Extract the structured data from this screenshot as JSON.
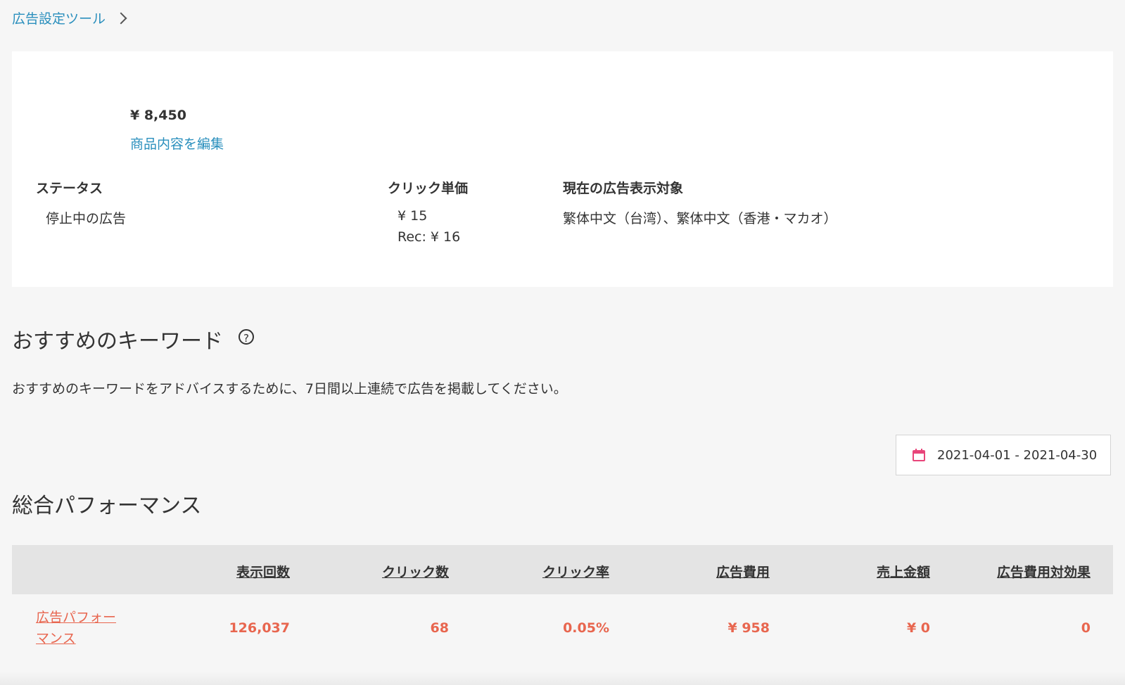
{
  "breadcrumb": {
    "link_label": "広告設定ツール"
  },
  "product": {
    "price": "¥ 8,450",
    "edit_label": "商品内容を編集"
  },
  "details": {
    "status_label": "ステータス",
    "status_value": "停止中の広告",
    "cpc_label": "クリック単価",
    "cpc_value": "¥ 15",
    "cpc_recommended": "Rec: ¥ 16",
    "target_label": "現在の広告表示対象",
    "target_value": "繁体中文（台湾）、繁体中文（香港・マカオ）"
  },
  "keywords": {
    "title": "おすすめのキーワード",
    "help_icon": "question-circle-icon",
    "help_glyph": "?",
    "advice": "おすすめのキーワードをアドバイスするために、7日間以上連続で広告を掲載してください。"
  },
  "date_range": {
    "icon": "calendar-icon",
    "value": "2021-04-01 - 2021-04-30",
    "icon_color": "#e8457a"
  },
  "performance": {
    "title": "総合パフォーマンス",
    "columns": [
      "表示回数",
      "クリック数",
      "クリック率",
      "広告費用",
      "売上金額",
      "広告費用対効果"
    ],
    "row_label": "広告パフォーマンス",
    "row_label_line1": "広告パフォー",
    "row_label_line2": "マンス",
    "values": [
      "126,037",
      "68",
      "0.05%",
      "¥ 958",
      "¥ 0",
      "0"
    ],
    "value_color": "#e8664f"
  },
  "colors": {
    "link": "#2a8fbd",
    "accent": "#e8664f",
    "background": "#f6f6f6",
    "table_header": "#e4e4e4"
  }
}
